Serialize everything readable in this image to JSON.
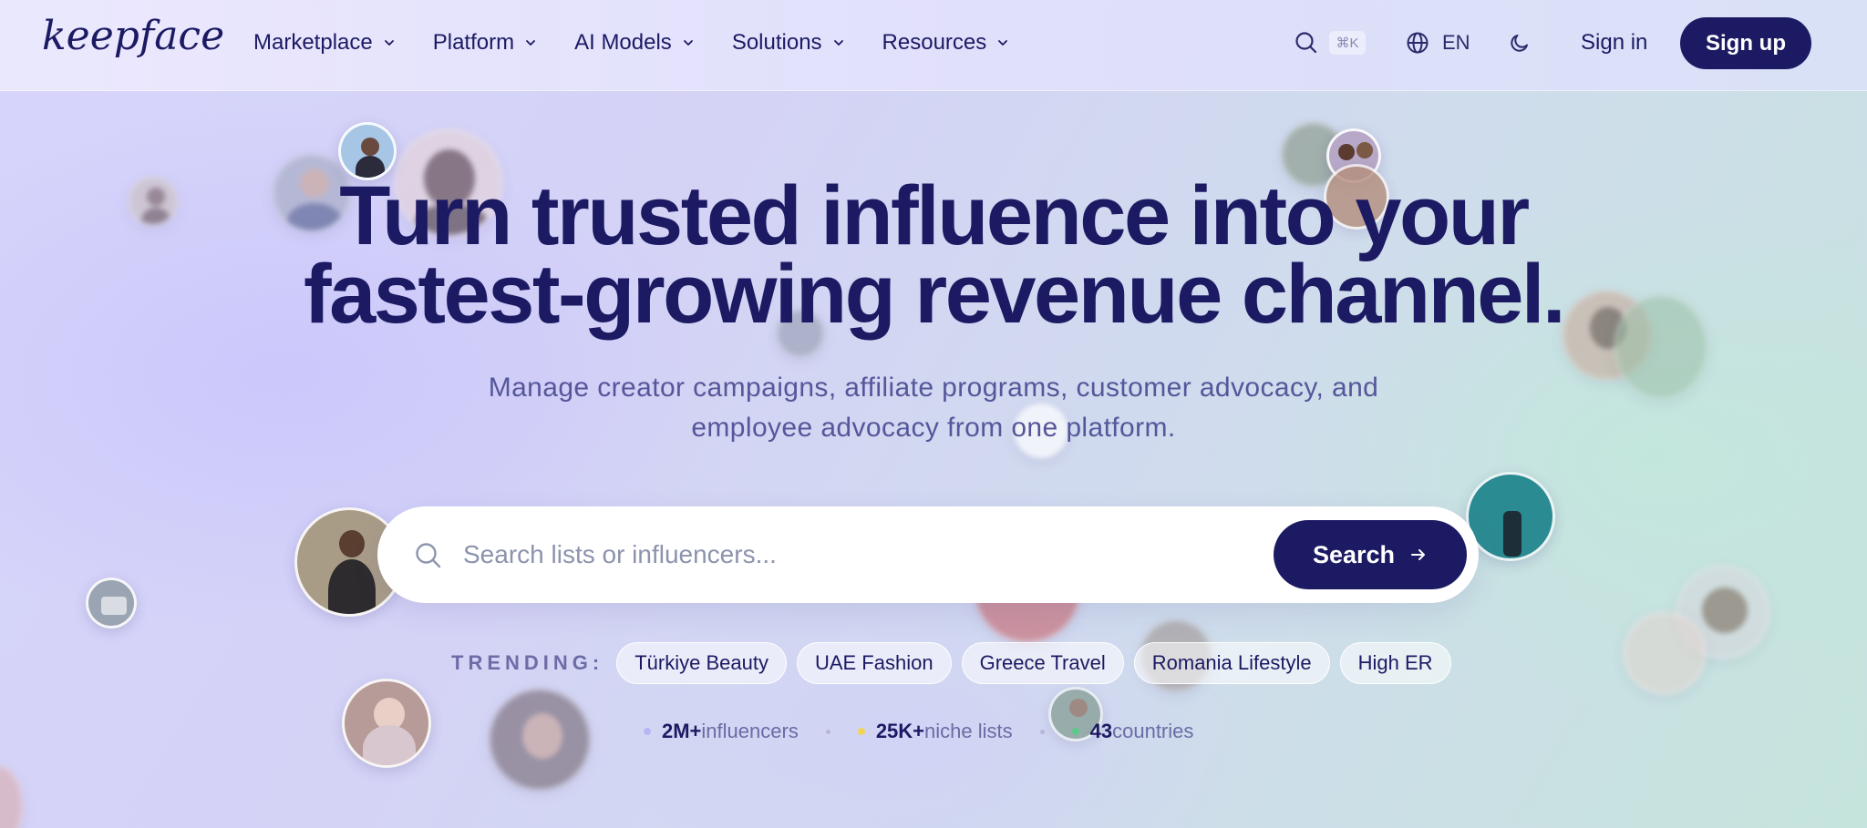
{
  "brand": {
    "logo_text": "keepface"
  },
  "nav": {
    "menu": [
      {
        "label": "Marketplace"
      },
      {
        "label": "Platform"
      },
      {
        "label": "AI Models"
      },
      {
        "label": "Solutions"
      },
      {
        "label": "Resources"
      }
    ],
    "search_shortcut": "⌘K",
    "language": "EN",
    "sign_in": "Sign in",
    "sign_up": "Sign up"
  },
  "hero": {
    "headline_line1": "Turn trusted influence into your",
    "headline_line2": "fastest-growing revenue channel.",
    "subheadline_line1": "Manage creator campaigns, affiliate programs, customer advocacy, and",
    "subheadline_line2": "employee advocacy from one platform."
  },
  "search": {
    "placeholder": "Search lists or influencers...",
    "button_label": "Search"
  },
  "trending": {
    "label": "TRENDING:",
    "chips": [
      "Türkiye Beauty",
      "UAE Fashion",
      "Greece Travel",
      "Romania Lifestyle",
      "High ER"
    ]
  },
  "stats": [
    {
      "value": "2M+",
      "label": "influencers",
      "dot_color": "#b9b6f5"
    },
    {
      "value": "25K+",
      "label": "niche lists",
      "dot_color": "#f2d35a"
    },
    {
      "value": "43",
      "label": "countries",
      "dot_color": "#5cc98a"
    }
  ],
  "colors": {
    "primary": "#1c1a63",
    "muted_text": "#56569a",
    "background_left": "#d6d4fb",
    "background_right": "#c5e4dc"
  },
  "icons": [
    "chevron-down-icon",
    "search-icon",
    "globe-icon",
    "moon-icon",
    "arrow-right-icon"
  ]
}
